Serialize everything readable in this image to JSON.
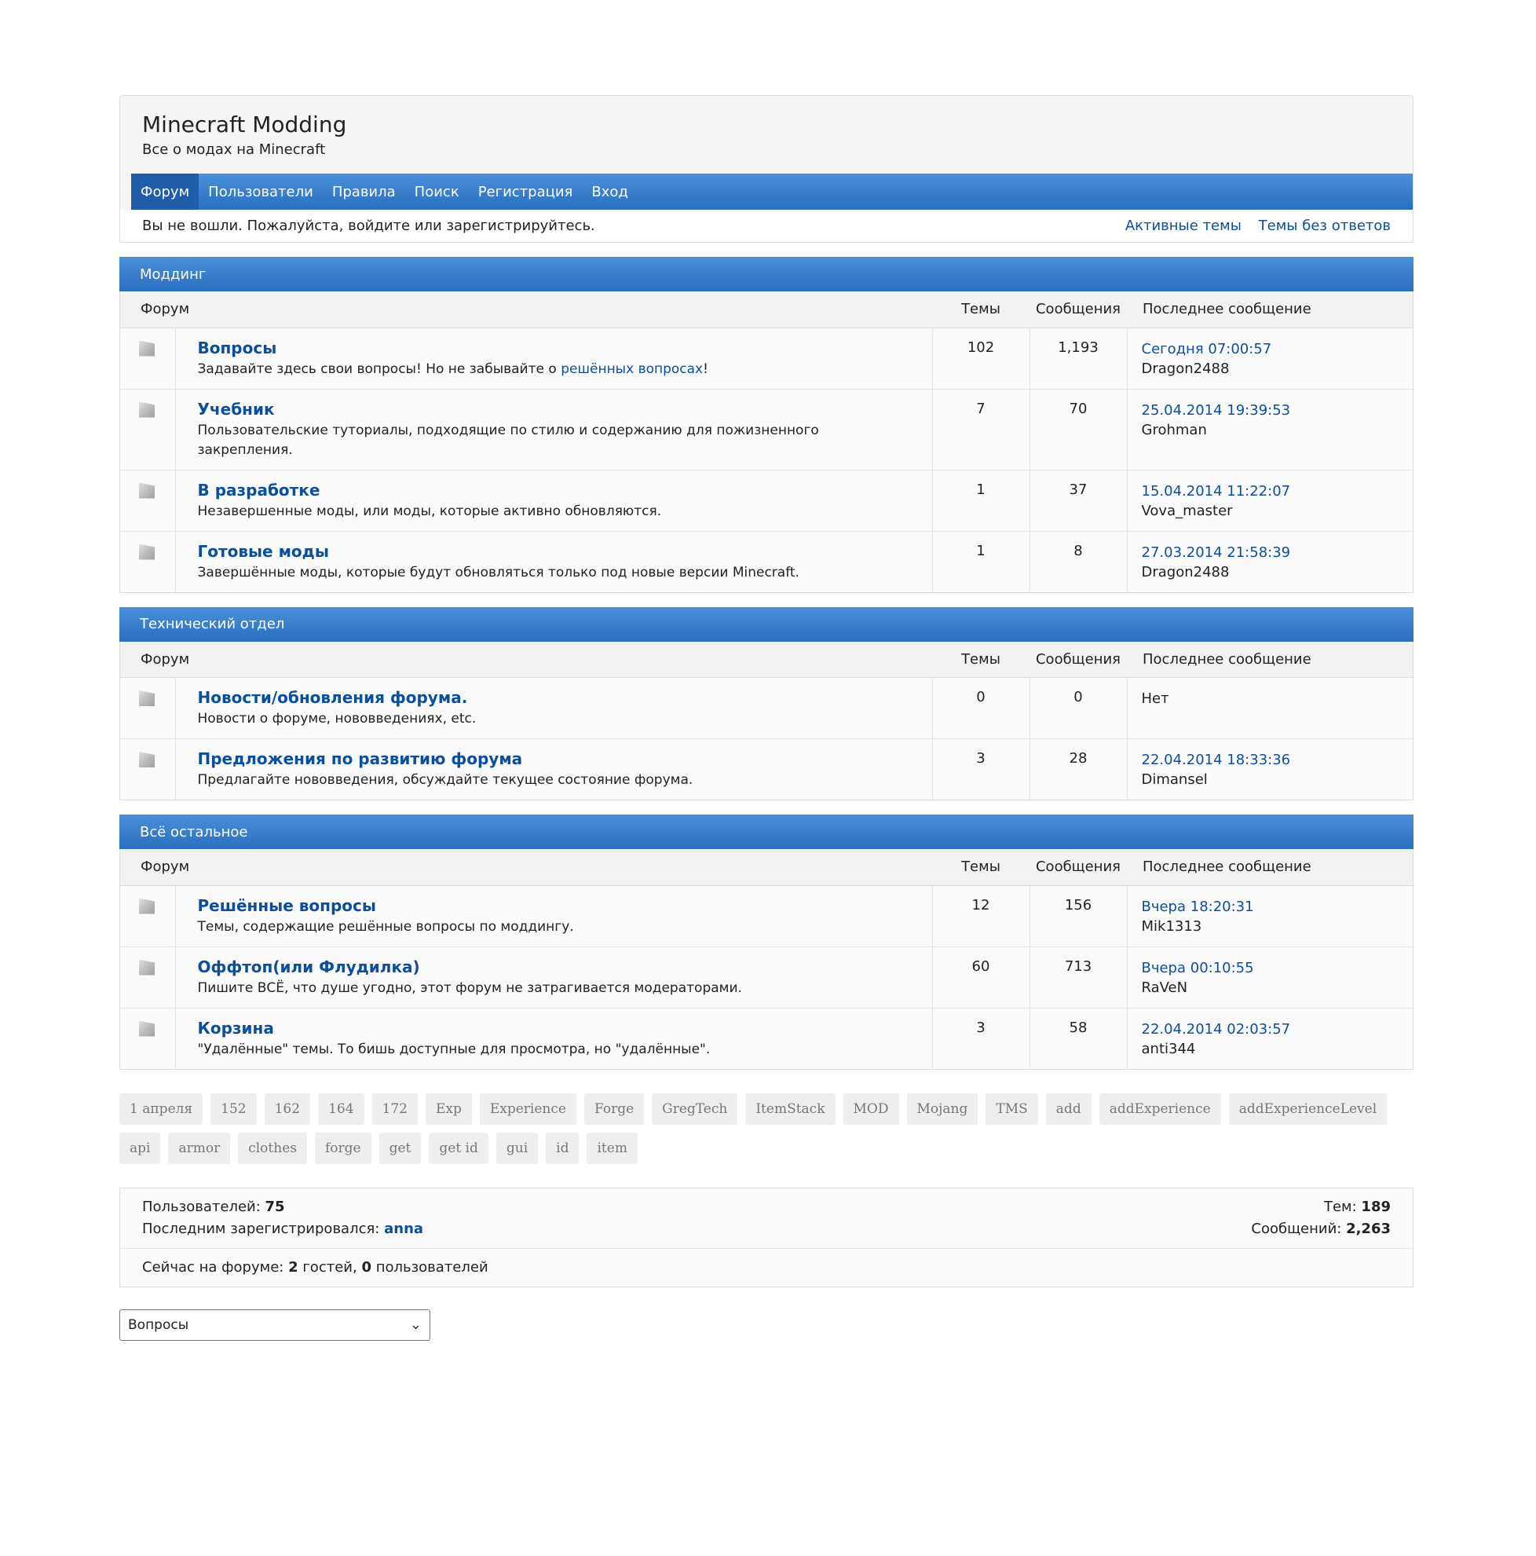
{
  "header": {
    "title": "Minecraft Modding",
    "description": "Все о модах на Minecraft"
  },
  "nav": [
    {
      "label": "Форум",
      "active": true
    },
    {
      "label": "Пользователи"
    },
    {
      "label": "Правила"
    },
    {
      "label": "Поиск"
    },
    {
      "label": "Регистрация"
    },
    {
      "label": "Вход"
    }
  ],
  "status": {
    "message": "Вы не вошли. Пожалуйста, войдите или зарегистрируйтесь.",
    "links": [
      "Активные темы",
      "Темы без ответов"
    ]
  },
  "columns": {
    "forum": "Форум",
    "topics": "Темы",
    "posts": "Сообщения",
    "last": "Последнее сообщение"
  },
  "categories": [
    {
      "name": "Моддинг",
      "forums": [
        {
          "name": "Вопросы",
          "desc_pre": "Задавайте здесь свои вопросы! Но не забывайте о ",
          "desc_link": "решённых вопросах",
          "desc_post": "!",
          "topics": "102",
          "posts": "1,193",
          "last_date": "Сегодня 07:00:57",
          "last_user": "Dragon2488"
        },
        {
          "name": "Учебник",
          "desc_pre": "Пользовательские туториалы, подходящие по стилю и содержанию для пожизненного закрепления.",
          "topics": "7",
          "posts": "70",
          "last_date": "25.04.2014 19:39:53",
          "last_user": "Grohman"
        },
        {
          "name": "В разработке",
          "desc_pre": "Незавершенные моды, или моды, которые активно обновляются.",
          "topics": "1",
          "posts": "37",
          "last_date": "15.04.2014 11:22:07",
          "last_user": "Vova_master"
        },
        {
          "name": "Готовые моды",
          "desc_pre": "Завершённые моды, которые будут обновляться только под новые версии Minecraft.",
          "topics": "1",
          "posts": "8",
          "last_date": "27.03.2014 21:58:39",
          "last_user": "Dragon2488"
        }
      ]
    },
    {
      "name": "Технический отдел",
      "forums": [
        {
          "name": "Новости/обновления форума.",
          "desc_pre": "Новости о форуме, нововведениях, etc.",
          "topics": "0",
          "posts": "0",
          "last_none": "Нет"
        },
        {
          "name": "Предложения по развитию форума",
          "desc_pre": "Предлагайте нововведения, обсуждайте текущее состояние форума.",
          "topics": "3",
          "posts": "28",
          "last_date": "22.04.2014 18:33:36",
          "last_user": "Dimansel"
        }
      ]
    },
    {
      "name": "Всё остальное",
      "forums": [
        {
          "name": "Решённые вопросы",
          "desc_pre": "Темы, содержащие решённые вопросы по моддингу.",
          "topics": "12",
          "posts": "156",
          "last_date": "Вчера 18:20:31",
          "last_user": "Mik1313"
        },
        {
          "name": "Оффтоп(или Флудилка)",
          "desc_pre": "Пишите ВСЁ, что душе угодно, этот форум не затрагивается модераторами.",
          "topics": "60",
          "posts": "713",
          "last_date": "Вчера 00:10:55",
          "last_user": "RaVeN"
        },
        {
          "name": "Корзина",
          "desc_pre": "\"Удалённые\" темы. То бишь доступные для просмотра, но \"удалённые\".",
          "topics": "3",
          "posts": "58",
          "last_date": "22.04.2014 02:03:57",
          "last_user": "anti344"
        }
      ]
    }
  ],
  "tags": [
    "1 апреля",
    "152",
    "162",
    "164",
    "172",
    "Exp",
    "Experience",
    "Forge",
    "GregTech",
    "ItemStack",
    "MOD",
    "Mojang",
    "TMS",
    "add",
    "addExperience",
    "addExperienceLevel",
    "api",
    "armor",
    "clothes",
    "forge",
    "get",
    "get id",
    "gui",
    "id",
    "item"
  ],
  "stats": {
    "users_label": "Пользователей:",
    "users_value": "75",
    "last_reg_label": "Последним зарегистрировался:",
    "last_reg_user": "anna",
    "topics_label": "Тем:",
    "topics_value": "189",
    "posts_label": "Сообщений:",
    "posts_value": "2,263",
    "online_pre": "Сейчас на форуме:",
    "online_guests": "2",
    "online_mid": "гостей,",
    "online_users": "0",
    "online_post": "пользователей"
  },
  "jump": {
    "selected": "Вопросы"
  }
}
